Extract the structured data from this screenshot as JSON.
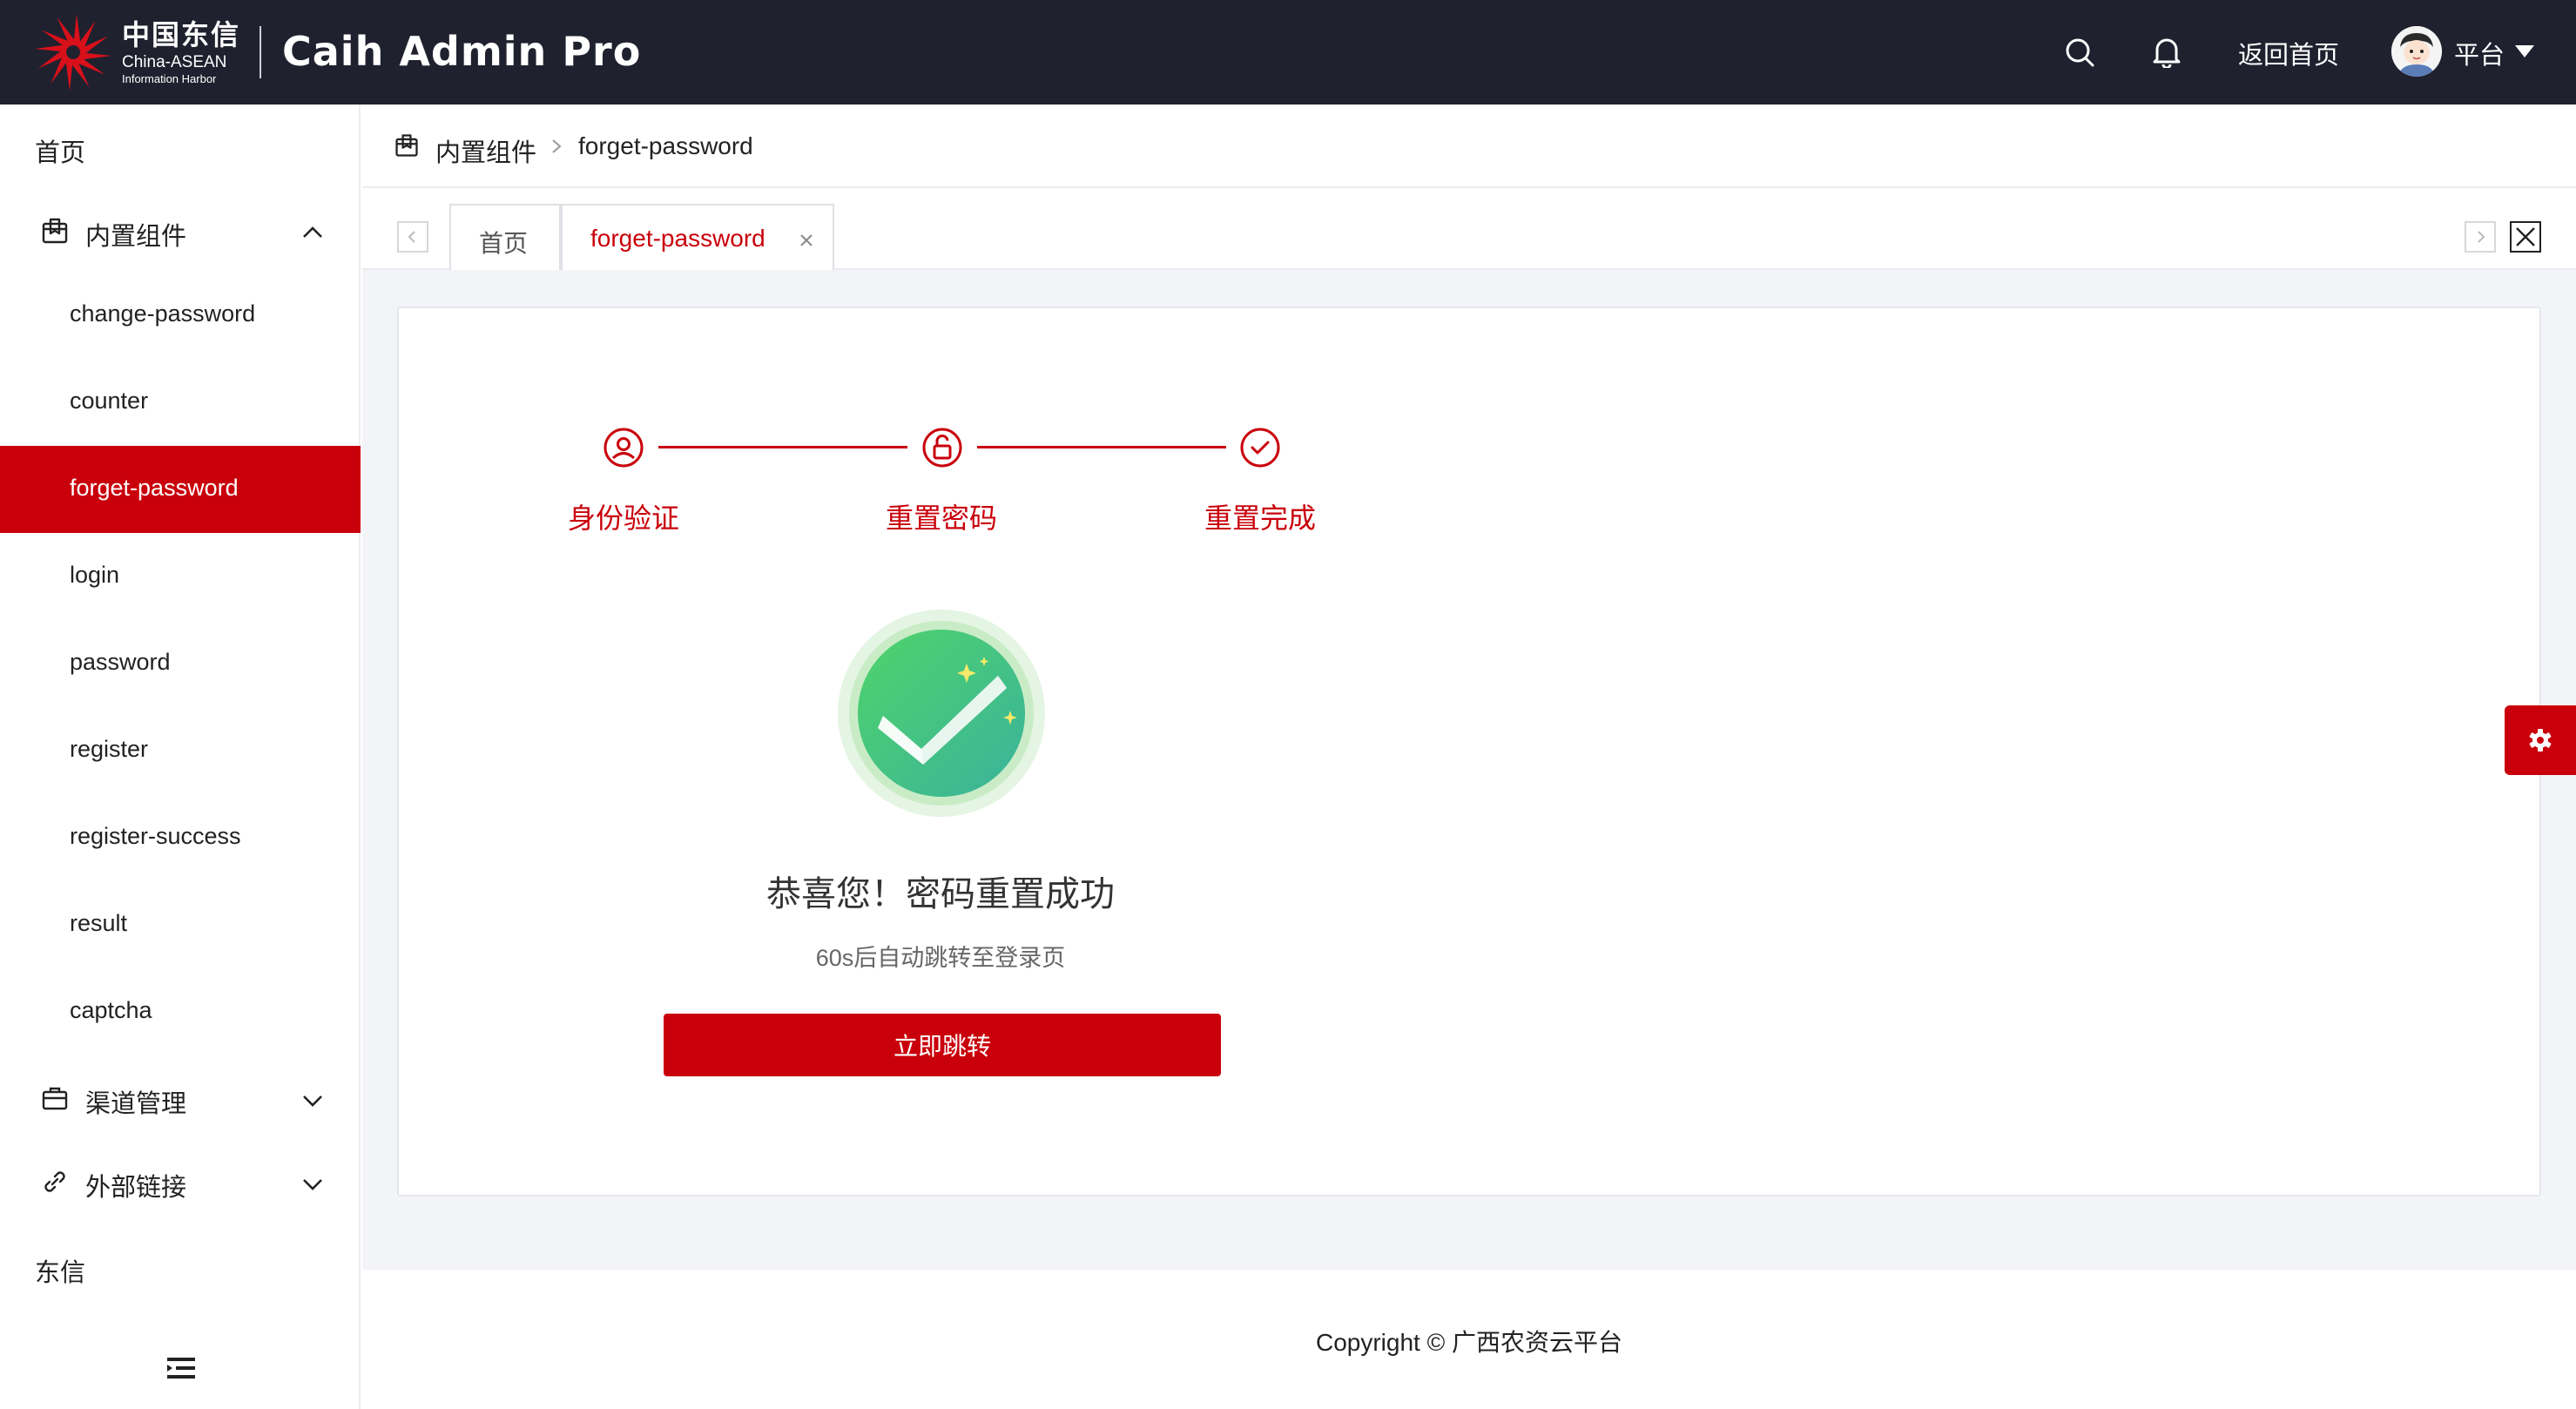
{
  "header": {
    "logo_cn": "中国东信",
    "logo_en_line1": "China-ASEAN",
    "logo_en_line2": "Information Harbor",
    "app_title": "Caih Admin Pro",
    "home_link": "返回首页",
    "user_name": "平台"
  },
  "sidebar": {
    "home": "首页",
    "group_builtin": "内置组件",
    "builtin_items": [
      "change-password",
      "counter",
      "forget-password",
      "login",
      "password",
      "register",
      "register-success",
      "result",
      "captcha"
    ],
    "active_item": "forget-password",
    "group_channel": "渠道管理",
    "group_links": "外部链接",
    "bottom": "东信"
  },
  "breadcrumb": {
    "root": "内置组件",
    "current": "forget-password"
  },
  "tabs": [
    {
      "label": "首页",
      "active": false
    },
    {
      "label": "forget-password",
      "active": true
    }
  ],
  "steps": [
    {
      "label": "身份验证",
      "icon": "user-circle-icon"
    },
    {
      "label": "重置密码",
      "icon": "unlock-icon"
    },
    {
      "label": "重置完成",
      "icon": "check-circle-icon"
    }
  ],
  "result": {
    "title": "恭喜您！密码重置成功",
    "subtitle": "60s后自动跳转至登录页",
    "button": "立即跳转"
  },
  "footer": {
    "copyright": "Copyright © 广西农资云平台"
  },
  "colors": {
    "brand": "#c9000b",
    "header_bg": "#20212f",
    "content_bg": "#f3f4f7",
    "success_green": "#3ec27a"
  }
}
